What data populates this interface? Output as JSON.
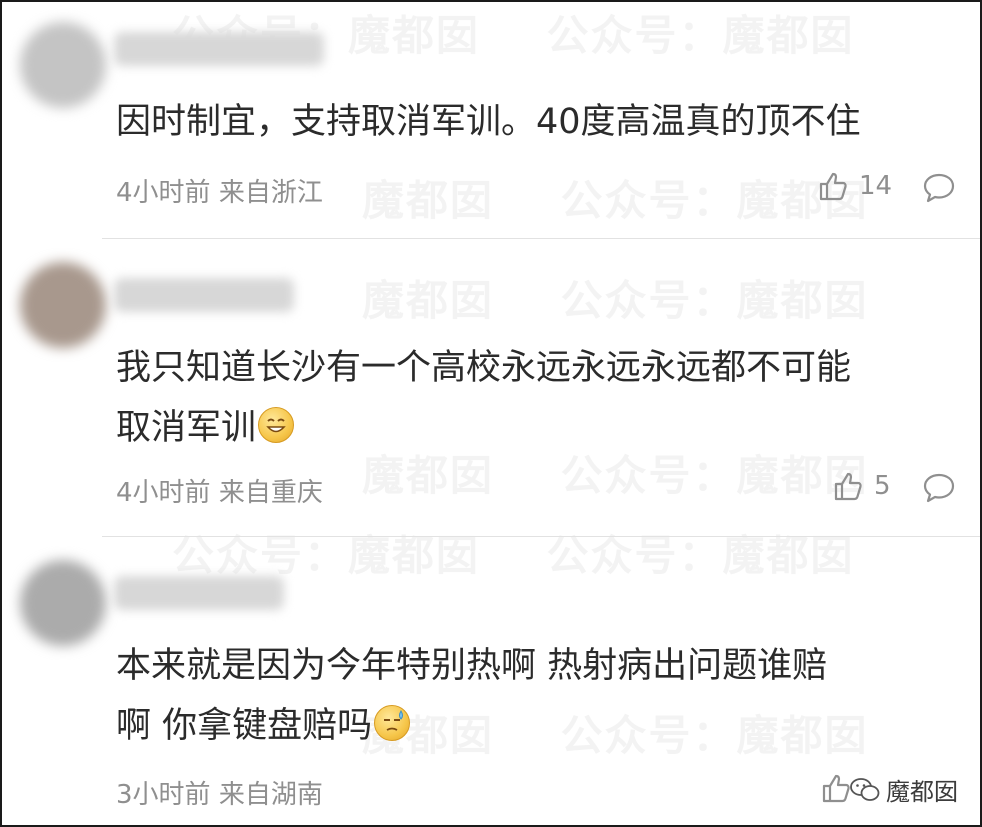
{
  "watermark_texts": [
    "魔都囡",
    "公众号：",
    "魔都囡",
    "公众号：",
    "魔都囡"
  ],
  "comments": [
    {
      "text": "因时制宜，支持取消军训。40度高温真的顶不住",
      "time": "4小时前",
      "location": "来自浙江",
      "likes": "14",
      "emoji": "",
      "avatar_color": "#bdbdbd"
    },
    {
      "text_line1": "我只知道长沙有一个高校永远永远永远都不可能",
      "text_line2": "取消军训",
      "time": "4小时前",
      "location": "来自重庆",
      "likes": "5",
      "emoji": "grinning-face",
      "avatar_color": "#a89a90"
    },
    {
      "text_line1": "本来就是因为今年特别热啊 热射病出问题谁赔",
      "text_line2": "啊 你拿键盘赔吗",
      "time": "3小时前",
      "location": "来自湖南",
      "likes": "",
      "emoji": "sweat-face",
      "avatar_color": "#aaaaaa"
    }
  ],
  "footer": {
    "brand": "魔都囡"
  },
  "colors": {
    "text": "#2b2b2b",
    "meta": "#8f8f8f",
    "divider": "#e2e2e2"
  }
}
